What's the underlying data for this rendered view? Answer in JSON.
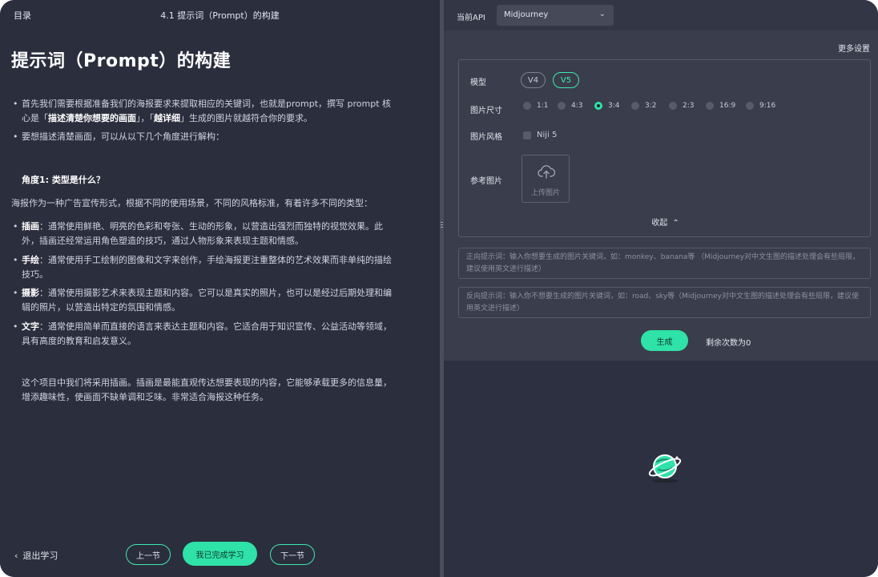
{
  "left": {
    "toc_label": "目录",
    "lesson_title": "4.1 提示词（Prompt）的构建",
    "article": {
      "title": "提示词（Prompt）的构建",
      "intro_1_a": "首先我们需要根据准备我们的海报要求来提取相应的关键词，也就是prompt，撰写 prompt 核",
      "intro_1_b1": "心是「",
      "intro_1_b_bold1": "描述清楚你想要的画面",
      "intro_1_b2": "」，「",
      "intro_1_b_bold2": "越详细",
      "intro_1_b3": "」生成的图片就越符合你的要求。",
      "intro_2": "要想描述清楚画面，可以从以下几个角度进行解构：",
      "section_heading": "角度1: 类型是什么？",
      "section_intro": "海报作为一种广告宣传形式，根据不同的使用场景，不同的风格标准，有着许多不同的类型：",
      "types": [
        {
          "name": "插画",
          "line1": "：通常使用鲜艳、明亮的色彩和夸张、生动的形象，以营造出强烈而独特的视觉效果。此",
          "line2": "外，插画还经常运用角色塑造的技巧，通过人物形象来表现主题和情感。"
        },
        {
          "name": "手绘",
          "line1": "：通常使用手工绘制的图像和文字来创作，手绘海报更注重整体的艺术效果而非单纯的描绘",
          "line2": "技巧。"
        },
        {
          "name": "摄影",
          "line1": "：通常使用摄影艺术来表现主题和内容。它可以是真实的照片，也可以是经过后期处理和编",
          "line2": "辑的照片，以营造出特定的氛围和情感。"
        },
        {
          "name": "文字",
          "line1": "：通常使用简单而直接的语言来表达主题和内容。它适合用于知识宣传、公益活动等领域，",
          "line2": "具有高度的教育和启发意义。"
        }
      ],
      "conclusion_1": "这个项目中我们将采用插画。插画是最能直观传达想要表现的内容，它能够承载更多的信息量，",
      "conclusion_2": "增添趣味性，使画面不缺单调和乏味。非常适合海报这种任务。"
    },
    "footer": {
      "exit": "退出学习",
      "prev": "上一节",
      "done": "我已完成学习",
      "next": "下一节"
    }
  },
  "right": {
    "api_label": "当前API",
    "api_selected": "Midjourney",
    "more_settings": "更多设置",
    "model_label": "模型",
    "models": [
      "V4",
      "V5"
    ],
    "model_selected": "V5",
    "size_label": "图片尺寸",
    "sizes": [
      "1:1",
      "4:3",
      "3:4",
      "3:2",
      "2:3",
      "16:9",
      "9:16"
    ],
    "size_selected": "3:4",
    "style_label": "图片风格",
    "style_option": "Niji 5",
    "ref_label": "参考图片",
    "upload_label": "上传图片",
    "collapse_label": "收起",
    "positive_placeholder": "正向提示词：输入你想要生成的图片关键词，如：monkey、banana等 （Midjourney对中文生图的描述处理会有些局限，建议使用英文进行描述）",
    "negative_placeholder": "反向提示词：输入你不想要生成的图片关键词，如：road、sky等（Midjourney对中文生图的描述处理会有些局限，建议使用英文进行描述）",
    "generate": "生成",
    "remaining": "剩余次数为0"
  },
  "colors": {
    "accent": "#2fe2a7",
    "left_bg": "#2b2e3d",
    "panel_bg": "#3a3d4b"
  }
}
